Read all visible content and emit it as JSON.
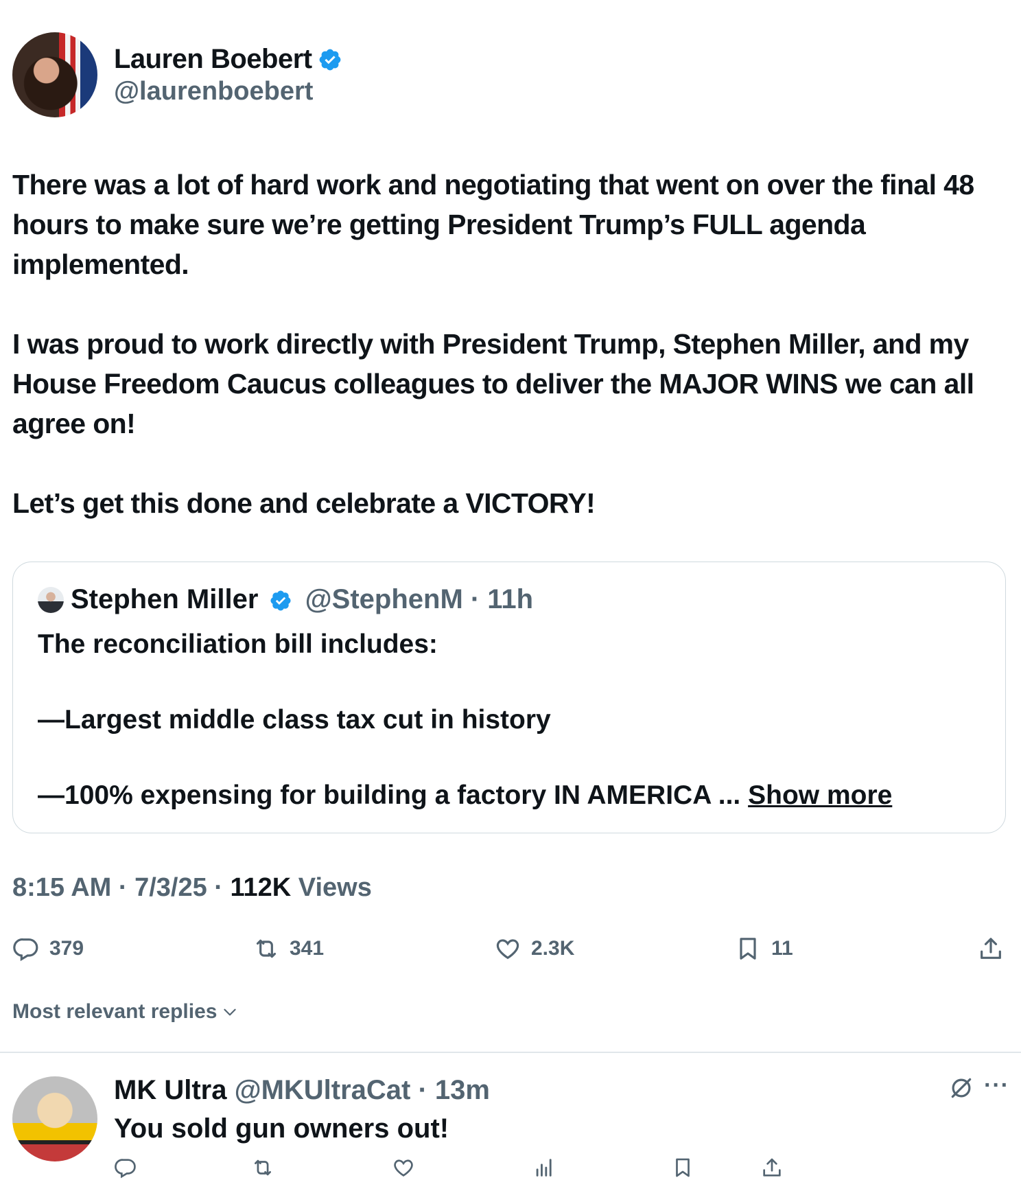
{
  "tweet": {
    "author": {
      "name": "Lauren Boebert",
      "handle": "@laurenboebert",
      "verified": true
    },
    "paragraphs": [
      "There was a lot of hard work and negotiating that went on over the final 48 hours to make sure we’re getting President Trump’s FULL agenda implemented.",
      "I was proud to work directly with President Trump, Stephen Miller, and my House Freedom Caucus colleagues to deliver the MAJOR WINS we can all agree on!",
      "Let’s get this done and celebrate a VICTORY!"
    ],
    "quote": {
      "author_name": "Stephen Miller",
      "handle_time": "@StephenM · 11h",
      "lines": [
        "The reconciliation bill includes:",
        "—Largest middle class tax cut in history",
        "—100% expensing for building a factory IN AMERICA ..."
      ],
      "show_more": "Show more"
    },
    "time": "8:15 AM · 7/3/25 · ",
    "views_count": "112K",
    "views_label": " Views",
    "actions": {
      "replies": "379",
      "reposts": "341",
      "likes": "2.3K",
      "bookmarks": "11"
    },
    "sort_label": "Most relevant replies"
  },
  "reply": {
    "name": "MK Ultra",
    "handle_time": "@MKUltraCat · 13m",
    "text": "You sold gun owners out!",
    "more": "···"
  },
  "colors": {
    "text": "#0f1419",
    "secondary": "#536471",
    "verified": "#1d9bf0",
    "border": "#cfd9de"
  }
}
